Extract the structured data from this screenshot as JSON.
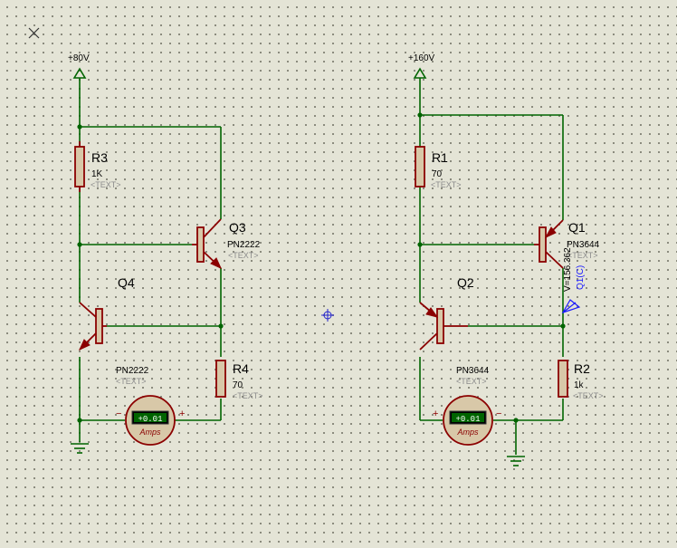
{
  "left_circuit": {
    "supply": "+80V",
    "r3": {
      "name": "R3",
      "value": "1K",
      "text": "<TEXT>"
    },
    "q3": {
      "name": "Q3",
      "model": "PN2222",
      "text": "<TEXT>"
    },
    "q4": {
      "name": "Q4",
      "model": "PN2222",
      "text": "<TEXT>"
    },
    "r4": {
      "name": "R4",
      "value": "70",
      "text": "<TEXT>"
    },
    "ammeter": {
      "reading": "+0.01",
      "unit": "Amps",
      "minus": "−",
      "plus": "+"
    }
  },
  "right_circuit": {
    "supply": "+160V",
    "r1": {
      "name": "R1",
      "value": "70",
      "text": "<TEXT>"
    },
    "q1": {
      "name": "Q1",
      "model": "PN3644",
      "text": "<TEXT>"
    },
    "q2": {
      "name": "Q2",
      "model": "PN3644",
      "text": "<TEXT>"
    },
    "r2": {
      "name": "R2",
      "value": "1k",
      "text": "<TEXT>"
    },
    "ammeter": {
      "reading": "+0.01",
      "unit": "Amps",
      "minus": "−",
      "plus": "+"
    },
    "probe": {
      "voltage": "V=156.362",
      "label": "Q1(C)"
    }
  },
  "colors": {
    "background": "#e4e4d6",
    "wire": "#006400",
    "component": "#8b0000",
    "probe": "#1a1aff",
    "meter_display": "#006400"
  }
}
